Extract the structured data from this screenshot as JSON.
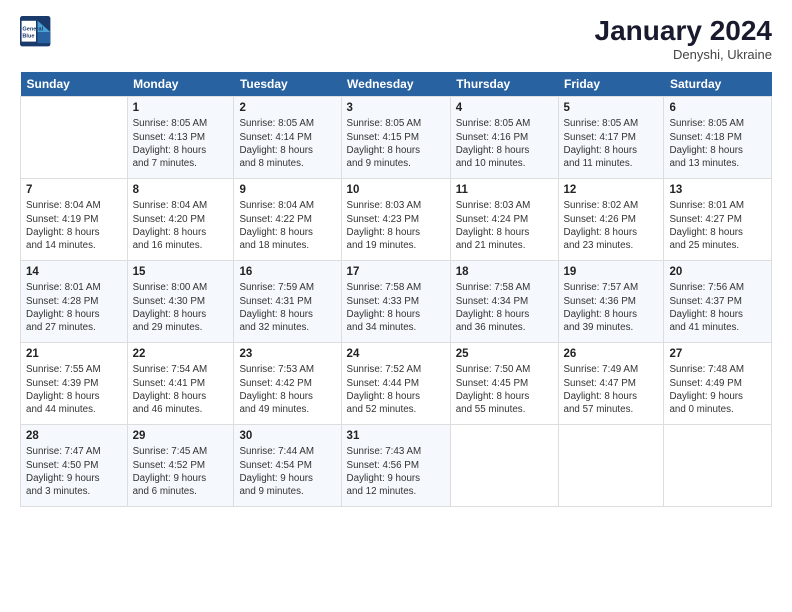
{
  "header": {
    "logo_line1": "General",
    "logo_line2": "Blue",
    "month_year": "January 2024",
    "location": "Denyshi, Ukraine"
  },
  "weekdays": [
    "Sunday",
    "Monday",
    "Tuesday",
    "Wednesday",
    "Thursday",
    "Friday",
    "Saturday"
  ],
  "weeks": [
    [
      {
        "day": "",
        "info": ""
      },
      {
        "day": "1",
        "info": "Sunrise: 8:05 AM\nSunset: 4:13 PM\nDaylight: 8 hours\nand 7 minutes."
      },
      {
        "day": "2",
        "info": "Sunrise: 8:05 AM\nSunset: 4:14 PM\nDaylight: 8 hours\nand 8 minutes."
      },
      {
        "day": "3",
        "info": "Sunrise: 8:05 AM\nSunset: 4:15 PM\nDaylight: 8 hours\nand 9 minutes."
      },
      {
        "day": "4",
        "info": "Sunrise: 8:05 AM\nSunset: 4:16 PM\nDaylight: 8 hours\nand 10 minutes."
      },
      {
        "day": "5",
        "info": "Sunrise: 8:05 AM\nSunset: 4:17 PM\nDaylight: 8 hours\nand 11 minutes."
      },
      {
        "day": "6",
        "info": "Sunrise: 8:05 AM\nSunset: 4:18 PM\nDaylight: 8 hours\nand 13 minutes."
      }
    ],
    [
      {
        "day": "7",
        "info": "Sunrise: 8:04 AM\nSunset: 4:19 PM\nDaylight: 8 hours\nand 14 minutes."
      },
      {
        "day": "8",
        "info": "Sunrise: 8:04 AM\nSunset: 4:20 PM\nDaylight: 8 hours\nand 16 minutes."
      },
      {
        "day": "9",
        "info": "Sunrise: 8:04 AM\nSunset: 4:22 PM\nDaylight: 8 hours\nand 18 minutes."
      },
      {
        "day": "10",
        "info": "Sunrise: 8:03 AM\nSunset: 4:23 PM\nDaylight: 8 hours\nand 19 minutes."
      },
      {
        "day": "11",
        "info": "Sunrise: 8:03 AM\nSunset: 4:24 PM\nDaylight: 8 hours\nand 21 minutes."
      },
      {
        "day": "12",
        "info": "Sunrise: 8:02 AM\nSunset: 4:26 PM\nDaylight: 8 hours\nand 23 minutes."
      },
      {
        "day": "13",
        "info": "Sunrise: 8:01 AM\nSunset: 4:27 PM\nDaylight: 8 hours\nand 25 minutes."
      }
    ],
    [
      {
        "day": "14",
        "info": "Sunrise: 8:01 AM\nSunset: 4:28 PM\nDaylight: 8 hours\nand 27 minutes."
      },
      {
        "day": "15",
        "info": "Sunrise: 8:00 AM\nSunset: 4:30 PM\nDaylight: 8 hours\nand 29 minutes."
      },
      {
        "day": "16",
        "info": "Sunrise: 7:59 AM\nSunset: 4:31 PM\nDaylight: 8 hours\nand 32 minutes."
      },
      {
        "day": "17",
        "info": "Sunrise: 7:58 AM\nSunset: 4:33 PM\nDaylight: 8 hours\nand 34 minutes."
      },
      {
        "day": "18",
        "info": "Sunrise: 7:58 AM\nSunset: 4:34 PM\nDaylight: 8 hours\nand 36 minutes."
      },
      {
        "day": "19",
        "info": "Sunrise: 7:57 AM\nSunset: 4:36 PM\nDaylight: 8 hours\nand 39 minutes."
      },
      {
        "day": "20",
        "info": "Sunrise: 7:56 AM\nSunset: 4:37 PM\nDaylight: 8 hours\nand 41 minutes."
      }
    ],
    [
      {
        "day": "21",
        "info": "Sunrise: 7:55 AM\nSunset: 4:39 PM\nDaylight: 8 hours\nand 44 minutes."
      },
      {
        "day": "22",
        "info": "Sunrise: 7:54 AM\nSunset: 4:41 PM\nDaylight: 8 hours\nand 46 minutes."
      },
      {
        "day": "23",
        "info": "Sunrise: 7:53 AM\nSunset: 4:42 PM\nDaylight: 8 hours\nand 49 minutes."
      },
      {
        "day": "24",
        "info": "Sunrise: 7:52 AM\nSunset: 4:44 PM\nDaylight: 8 hours\nand 52 minutes."
      },
      {
        "day": "25",
        "info": "Sunrise: 7:50 AM\nSunset: 4:45 PM\nDaylight: 8 hours\nand 55 minutes."
      },
      {
        "day": "26",
        "info": "Sunrise: 7:49 AM\nSunset: 4:47 PM\nDaylight: 8 hours\nand 57 minutes."
      },
      {
        "day": "27",
        "info": "Sunrise: 7:48 AM\nSunset: 4:49 PM\nDaylight: 9 hours\nand 0 minutes."
      }
    ],
    [
      {
        "day": "28",
        "info": "Sunrise: 7:47 AM\nSunset: 4:50 PM\nDaylight: 9 hours\nand 3 minutes."
      },
      {
        "day": "29",
        "info": "Sunrise: 7:45 AM\nSunset: 4:52 PM\nDaylight: 9 hours\nand 6 minutes."
      },
      {
        "day": "30",
        "info": "Sunrise: 7:44 AM\nSunset: 4:54 PM\nDaylight: 9 hours\nand 9 minutes."
      },
      {
        "day": "31",
        "info": "Sunrise: 7:43 AM\nSunset: 4:56 PM\nDaylight: 9 hours\nand 12 minutes."
      },
      {
        "day": "",
        "info": ""
      },
      {
        "day": "",
        "info": ""
      },
      {
        "day": "",
        "info": ""
      }
    ]
  ]
}
